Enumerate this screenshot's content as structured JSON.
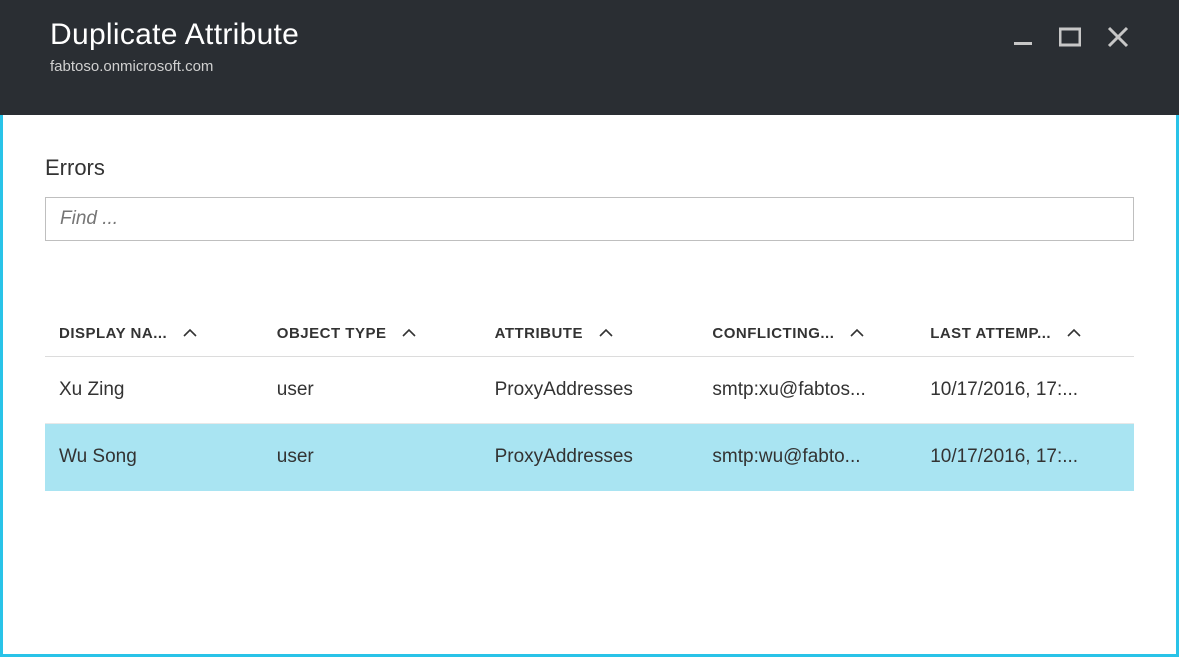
{
  "header": {
    "title": "Duplicate Attribute",
    "subtitle": "fabtoso.onmicrosoft.com"
  },
  "section": {
    "title": "Errors",
    "search_placeholder": "Find ..."
  },
  "table": {
    "columns": [
      "DISPLAY NA...",
      "OBJECT TYPE",
      "ATTRIBUTE",
      "CONFLICTING...",
      "LAST ATTEMP..."
    ],
    "rows": [
      {
        "display_name": "Xu Zing",
        "object_type": "user",
        "attribute": "ProxyAddresses",
        "conflicting": "smtp:xu@fabtos...",
        "last_attempt": "10/17/2016, 17:...",
        "selected": false
      },
      {
        "display_name": "Wu Song",
        "object_type": "user",
        "attribute": "ProxyAddresses",
        "conflicting": "smtp:wu@fabto...",
        "last_attempt": "10/17/2016, 17:...",
        "selected": true
      }
    ]
  }
}
